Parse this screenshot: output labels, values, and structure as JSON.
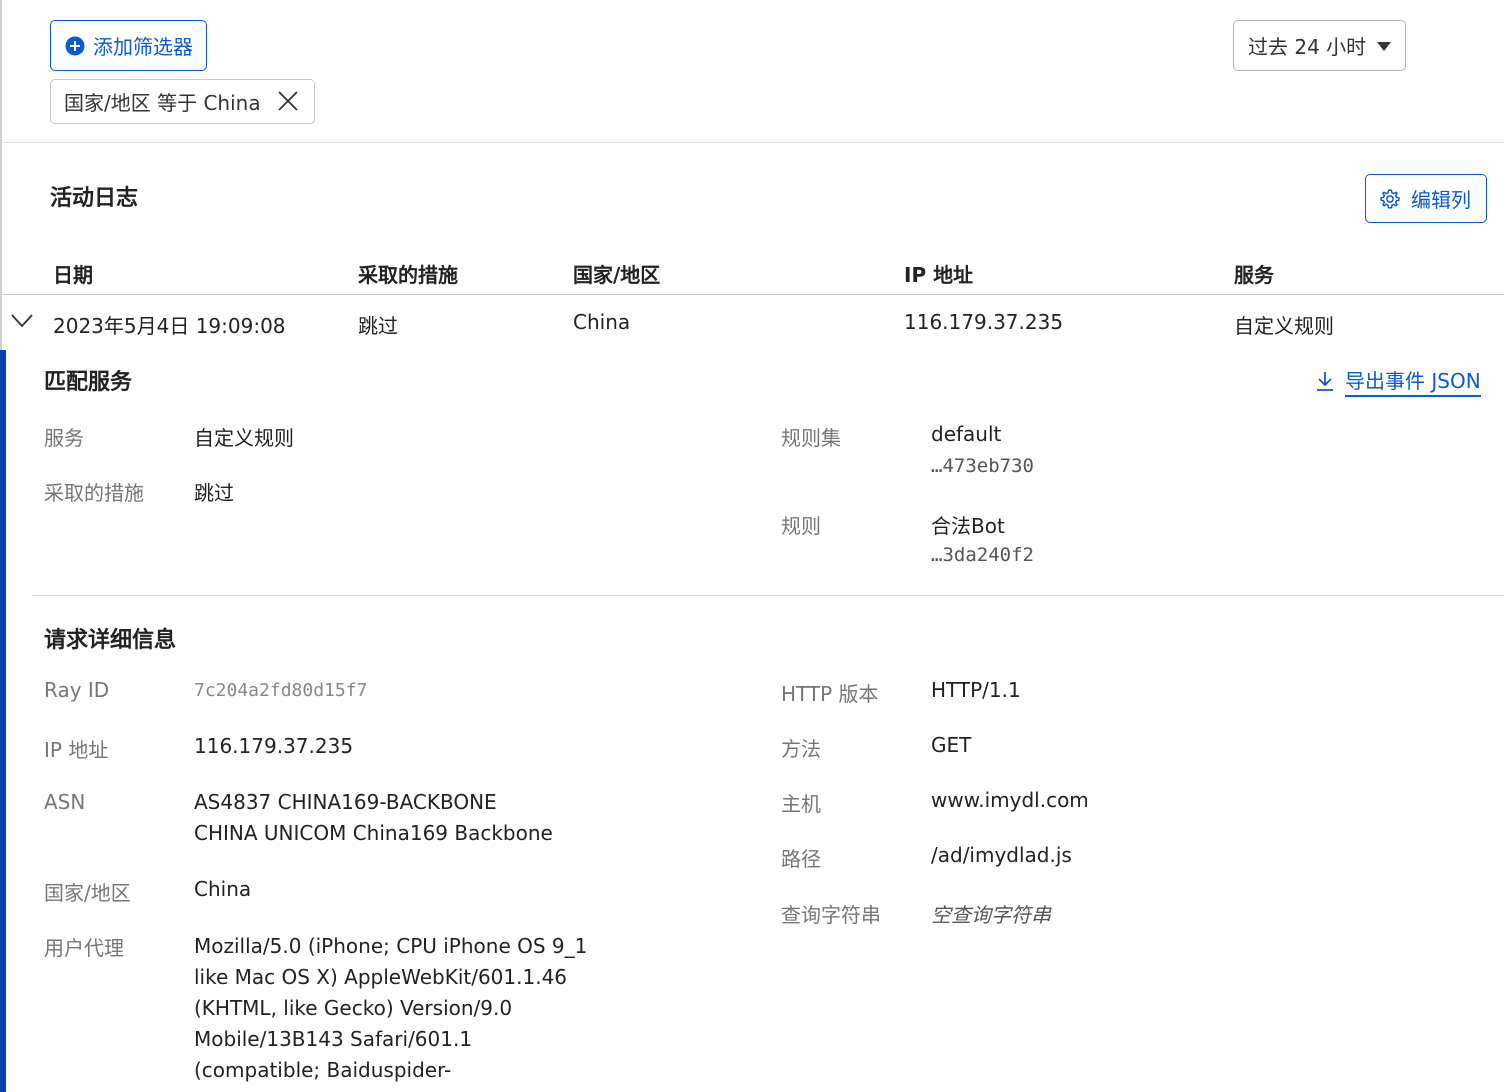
{
  "toolbar": {
    "add_filter_label": "添加筛选器",
    "filter_chip": "国家/地区 等于 China",
    "time_range": "过去 24 小时"
  },
  "activity_log": {
    "title": "活动日志",
    "edit_columns_label": "编辑列",
    "columns": [
      "日期",
      "采取的措施",
      "国家/地区",
      "IP 地址",
      "服务"
    ],
    "row": {
      "date": "2023年5月4日 19:09:08",
      "action": "跳过",
      "country": "China",
      "ip": "116.179.37.235",
      "service": "自定义规则"
    }
  },
  "matched_service": {
    "title": "匹配服务",
    "export_label": "导出事件 JSON",
    "service_label": "服务",
    "service_value": "自定义规则",
    "action_label": "采取的措施",
    "action_value": "跳过",
    "ruleset_label": "规则集",
    "ruleset_value": "default",
    "ruleset_id": "…473eb730",
    "rule_label": "规则",
    "rule_value": "合法Bot",
    "rule_id": "…3da240f2"
  },
  "request_details": {
    "title": "请求详细信息",
    "ray_id_label": "Ray ID",
    "ray_id_value": "7c204a2fd80d15f7",
    "ip_label": "IP 地址",
    "ip_value": "116.179.37.235",
    "asn_label": "ASN",
    "asn_line1": "AS4837 CHINA169-BACKBONE",
    "asn_line2": "CHINA UNICOM China169 Backbone",
    "country_label": "国家/地区",
    "country_value": "China",
    "ua_label": "用户代理",
    "ua_value": "Mozilla/5.0 (iPhone; CPU iPhone OS 9_1 like Mac OS X) AppleWebKit/601.1.46 (KHTML, like Gecko) Version/9.0 Mobile/13B143 Safari/601.1 (compatible; Baiduspider-",
    "http_label": "HTTP 版本",
    "http_value": "HTTP/1.1",
    "method_label": "方法",
    "method_value": "GET",
    "host_label": "主机",
    "host_value": "www.imydl.com",
    "path_label": "路径",
    "path_value": "/ad/imydlad.js",
    "query_label": "查询字符串",
    "query_value": "空查询字符串"
  }
}
